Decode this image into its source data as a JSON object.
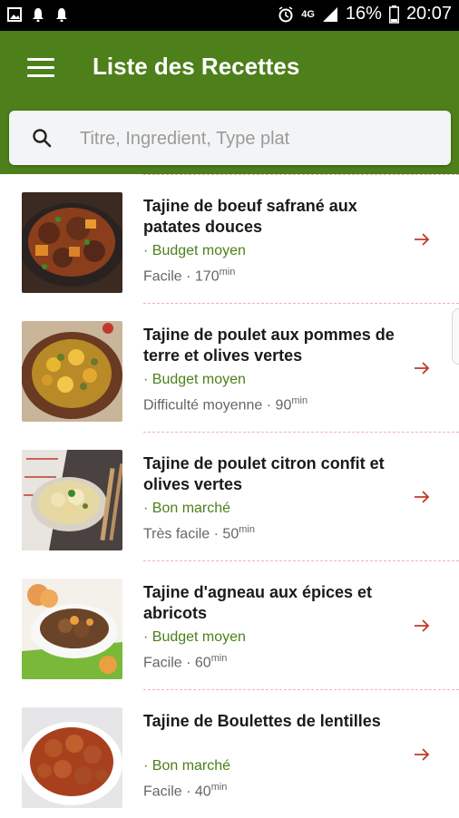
{
  "status_bar": {
    "battery_percent": "16%",
    "time": "20:07",
    "network": "4G",
    "icons": [
      "gallery-icon",
      "notification-icon",
      "notification-icon",
      "alarm-icon",
      "signal-icon",
      "battery-icon"
    ]
  },
  "app_bar": {
    "title": "Liste des Recettes",
    "color": "#4d7f1a"
  },
  "search": {
    "placeholder": "Titre, Ingredient, Type plat",
    "value": ""
  },
  "recipes": [
    {
      "title": "Tajine de boeuf safrané aux patates douces",
      "budget": "· Budget moyen",
      "difficulty": "Facile",
      "time": "170",
      "unit": "min"
    },
    {
      "title": "Tajine de poulet aux pommes de terre et olives vertes",
      "budget": "· Budget moyen",
      "difficulty": "Difficulté moyenne",
      "time": "90",
      "unit": "min"
    },
    {
      "title": "Tajine de poulet citron confit et olives vertes",
      "budget": "· Bon marché",
      "difficulty": "Très facile",
      "time": "50",
      "unit": "min"
    },
    {
      "title": "Tajine d'agneau aux épices et abricots",
      "budget": "· Budget moyen",
      "difficulty": "Facile",
      "time": "60",
      "unit": "min"
    },
    {
      "title": "Tajine de Boulettes de lentilles",
      "budget": "· Bon marché",
      "difficulty": "Facile",
      "time": "40",
      "unit": "min"
    }
  ]
}
